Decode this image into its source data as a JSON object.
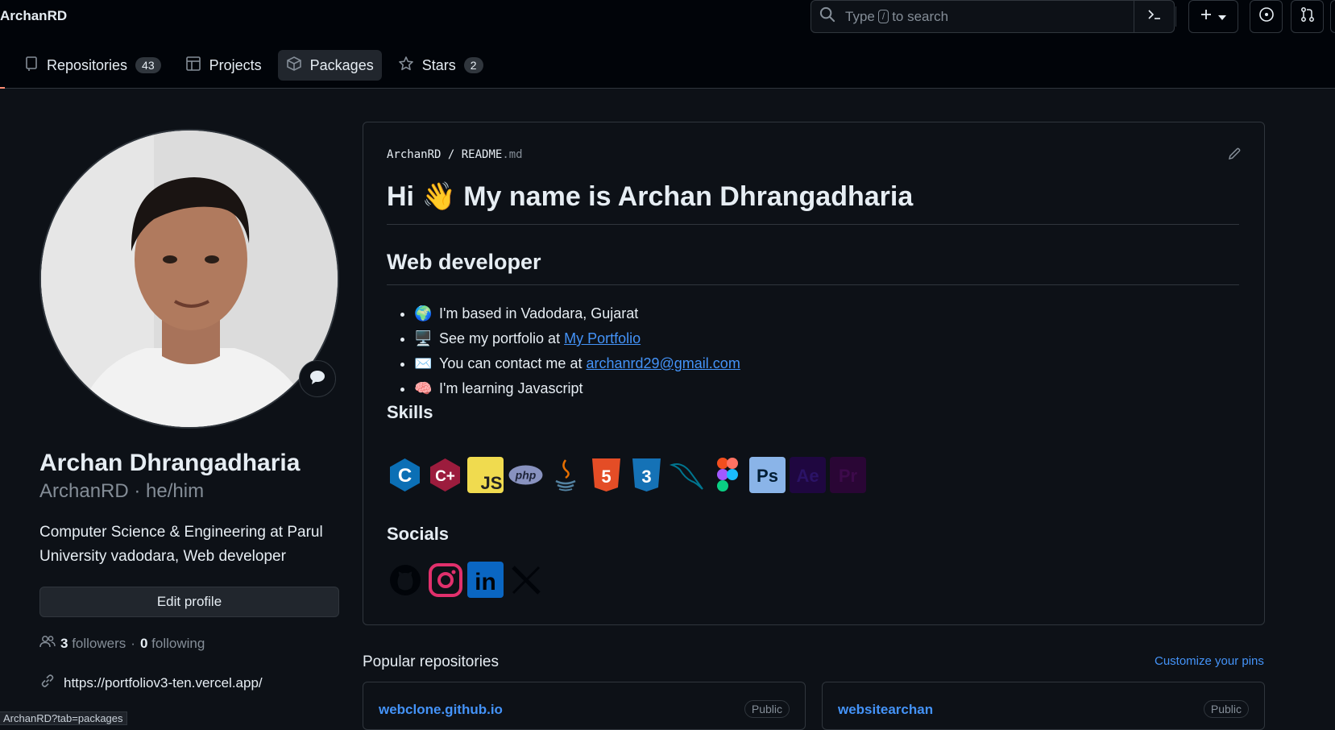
{
  "header": {
    "owner": "ArchanRD",
    "search": {
      "before": "Type",
      "key": "/",
      "after": "to search"
    },
    "tabs": [
      {
        "label": "Repositories",
        "count": "43",
        "icon": "repo-icon"
      },
      {
        "label": "Projects",
        "count": "",
        "icon": "table-icon"
      },
      {
        "label": "Packages",
        "count": "",
        "icon": "package-icon",
        "active": true
      },
      {
        "label": "Stars",
        "count": "2",
        "icon": "star-icon"
      }
    ]
  },
  "profile": {
    "name": "Archan Dhrangadharia",
    "login_line": "ArchanRD · he/him",
    "bio": "Computer Science & Engineering at Parul University vadodara, Web developer",
    "edit_label": "Edit profile",
    "followers": "3",
    "followers_label": "followers",
    "following": "0",
    "following_label": "following",
    "separator": "·",
    "website": "https://portfoliov3-ten.vercel.app/"
  },
  "readme": {
    "crumb_owner": "ArchanRD",
    "crumb_sep": "/",
    "crumb_file": "README",
    "crumb_ext": ".md",
    "title": "Hi 👋 My name is Archan Dhrangadharia",
    "subtitle": "Web developer",
    "bullets": [
      {
        "emoji": "🌍",
        "text": "I'm based in Vadodara, Gujarat",
        "link": ""
      },
      {
        "emoji": "🖥️",
        "text": "See my portfolio at ",
        "link": "My Portfolio"
      },
      {
        "emoji": "✉️",
        "text": "You can contact me at ",
        "link": "archanrd29@gmail.com"
      },
      {
        "emoji": "🧠",
        "text": "I'm learning Javascript",
        "link": ""
      }
    ],
    "skills_heading": "Skills",
    "skills": [
      {
        "name": "c-icon",
        "label": "C",
        "bg": "transparent",
        "fg": "#0b6fb5"
      },
      {
        "name": "cplusplus-icon",
        "label": "C++",
        "bg": "transparent",
        "fg": "#9c1c3d"
      },
      {
        "name": "javascript-icon",
        "label": "JS",
        "bg": "#f0db4f",
        "fg": "#222222"
      },
      {
        "name": "php-icon",
        "label": "php",
        "bg": "transparent",
        "fg": "#8892bf"
      },
      {
        "name": "java-icon",
        "label": "☕",
        "bg": "transparent",
        "fg": "#e76f00"
      },
      {
        "name": "html5-icon",
        "label": "5",
        "bg": "#e44d26",
        "fg": "#ffffff"
      },
      {
        "name": "css3-icon",
        "label": "3",
        "bg": "#1572b6",
        "fg": "#ffffff"
      },
      {
        "name": "mysql-icon",
        "label": "🐬",
        "bg": "transparent",
        "fg": "#00758f"
      },
      {
        "name": "figma-icon",
        "label": "",
        "bg": "transparent",
        "fg": "#f24e1e"
      },
      {
        "name": "photoshop-icon",
        "label": "Ps",
        "bg": "#8ab4e8",
        "fg": "#001d34"
      },
      {
        "name": "aftereffects-icon",
        "label": "Ae",
        "bg": "#1f0740",
        "fg": "#2b1366"
      },
      {
        "name": "premiere-icon",
        "label": "Pr",
        "bg": "#2a0635",
        "fg": "#3d0a4b"
      }
    ],
    "socials_heading": "Socials",
    "socials": [
      {
        "name": "github-icon"
      },
      {
        "name": "instagram-icon"
      },
      {
        "name": "linkedin-icon",
        "label": "in"
      },
      {
        "name": "x-icon",
        "label": "X"
      }
    ]
  },
  "popular": {
    "heading": "Popular repositories",
    "customize": "Customize your pins",
    "repos": [
      {
        "name": "webclone.github.io",
        "visibility": "Public"
      },
      {
        "name": "websitearchan",
        "visibility": "Public"
      }
    ]
  },
  "status_url": "ArchanRD?tab=packages"
}
